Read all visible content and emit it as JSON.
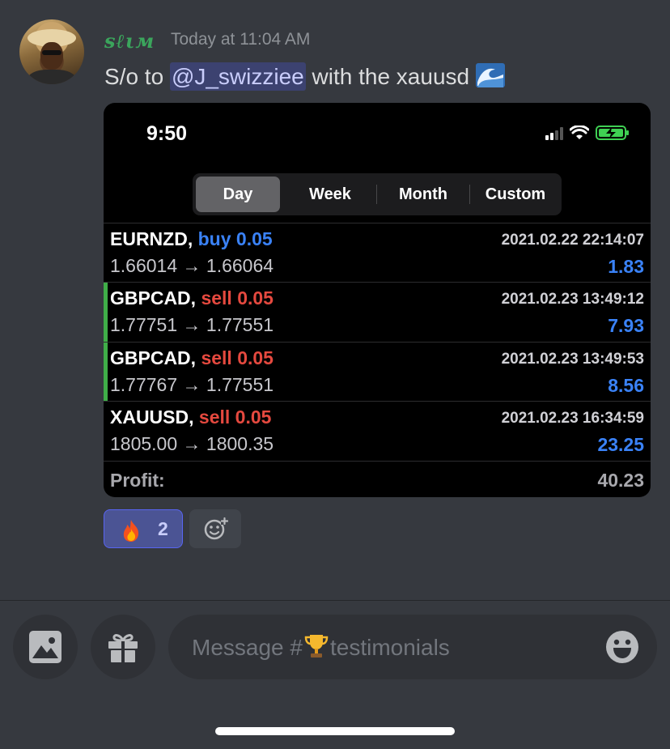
{
  "message": {
    "username": "sℓιм",
    "timestamp": "Today at 11:04 AM",
    "text_before": "S/o to ",
    "mention": "@J_swizziee",
    "text_after": " with the xauusd ",
    "emoji": "water-wave-emoji"
  },
  "screenshot": {
    "clock": "9:50",
    "tabs": [
      {
        "label": "Day",
        "active": true
      },
      {
        "label": "Week",
        "active": false
      },
      {
        "label": "Month",
        "active": false
      },
      {
        "label": "Custom",
        "active": false
      }
    ],
    "trades": [
      {
        "symbol": "EURNZD,",
        "direction": "buy 0.05",
        "type": "buy",
        "prices": "1.66014 → 1.66064",
        "datetime": "2021.02.22 22:14:07",
        "profit": "1.83"
      },
      {
        "symbol": "GBPCAD,",
        "direction": "sell 0.05",
        "type": "sell",
        "prices": "1.77751 → 1.77551",
        "datetime": "2021.02.23 13:49:12",
        "profit": "7.93"
      },
      {
        "symbol": "GBPCAD,",
        "direction": "sell 0.05",
        "type": "sell",
        "prices": "1.77767 → 1.77551",
        "datetime": "2021.02.23 13:49:53",
        "profit": "8.56"
      },
      {
        "symbol": "XAUUSD,",
        "direction": "sell 0.05",
        "type": "sell",
        "prices": "1805.00 → 1800.35",
        "datetime": "2021.02.23 16:34:59",
        "profit": "23.25"
      }
    ],
    "total_label": "Profit:",
    "total_value": "40.23"
  },
  "reactions": {
    "fire": {
      "emoji": "fire-emoji",
      "count": "2"
    },
    "add_icon": "add-reaction-icon"
  },
  "composer": {
    "placeholder_prefix": "Message #",
    "channel_emoji": "trophy-emoji",
    "channel_name": "testimonials",
    "image_icon": "image-icon",
    "gift_icon": "gift-icon",
    "emoji_icon": "smiley-icon"
  },
  "colors": {
    "background": "#36393f",
    "username": "#3ba55c",
    "buy": "#3a82f7",
    "sell": "#e5493f",
    "accent_bar": "#3fae48",
    "reaction_bg": "#4b5494"
  }
}
